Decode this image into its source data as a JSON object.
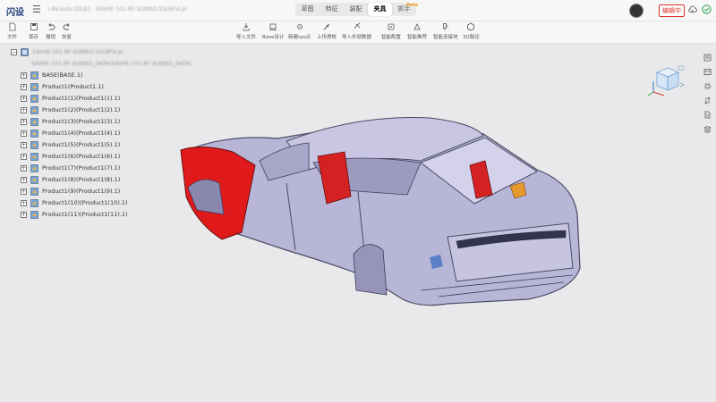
{
  "app": {
    "logo": "闪设",
    "doc_title": "I.AV.Auto.SSLB1 · SAVHE-101-RF-SUBBIO.SSLBP.A.pl"
  },
  "mode_tabs": [
    {
      "label": "草图",
      "active": false
    },
    {
      "label": "特征",
      "active": false
    },
    {
      "label": "装配",
      "active": false
    },
    {
      "label": "夹具",
      "active": true
    },
    {
      "label": "抓手",
      "active": false,
      "badge": "Beta"
    }
  ],
  "header": {
    "edit_button": "编辑中"
  },
  "toolbar": {
    "left": [
      {
        "label": "文件",
        "icon": "file-icon"
      },
      {
        "label": "保存",
        "icon": "save-icon"
      },
      {
        "label": "撤销",
        "icon": "undo-icon"
      },
      {
        "label": "恢复",
        "icon": "redo-icon"
      }
    ],
    "tools": [
      {
        "label": "导入文件",
        "icon": "import-icon"
      },
      {
        "label": "Base设计",
        "icon": "base-icon"
      },
      {
        "label": "新建rps点",
        "icon": "rps-icon"
      },
      {
        "label": "上传焊枪",
        "icon": "weld-gun-icon"
      },
      {
        "label": "导入外部数据",
        "icon": "import-data-icon"
      },
      {
        "label": "智能配置",
        "icon": "smart-config-icon"
      },
      {
        "label": "智能推荐",
        "icon": "smart-recommend-icon"
      },
      {
        "label": "智能连接块",
        "icon": "connector-icon"
      },
      {
        "label": "3D路径",
        "icon": "path-icon"
      }
    ]
  },
  "tree": {
    "root_label": "SAVHE-101-RF-SUBBIO.SSLBP.A.pl",
    "root_child": "SAVHE-101-RF-SUBBIO_DATA(SAVHE-101-RF-SUBBIO_DATA)",
    "items": [
      "BASE(BASE.1)",
      "Product1(Product1.1)",
      "Product1(1)(Product1(1).1)",
      "Product1(2)(Product1(2).1)",
      "Product1(3)(Product1(3).1)",
      "Product1(4)(Product1(4).1)",
      "Product1(5)(Product1(5).1)",
      "Product1(6)(Product1(6).1)",
      "Product1(7)(Product1(7).1)",
      "Product1(8)(Product1(8).1)",
      "Product1(9)(Product1(9).1)",
      "Product1(10)(Product1(10).1)",
      "Product1(11)(Product1(11).1)"
    ]
  },
  "colors": {
    "accent": "#d9302a",
    "highlight": "#e01a1a",
    "body": "#b8b6d6"
  },
  "right_sidebar": [
    "layers-icon",
    "list-icon",
    "settings-icon",
    "sort-icon",
    "document-icon",
    "stack-icon"
  ]
}
